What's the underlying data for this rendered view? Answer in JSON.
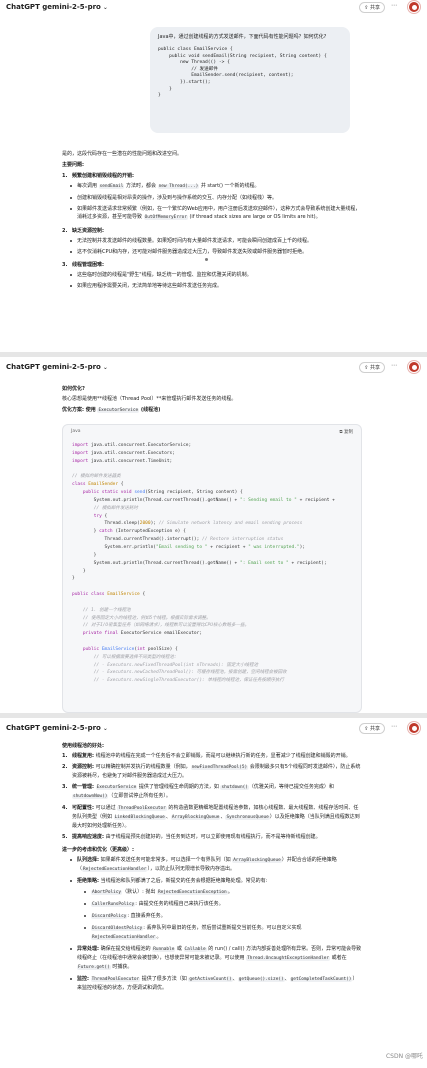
{
  "header": {
    "title": "ChatGPT gemini-2-5-pro",
    "chevron": "⌄",
    "share_label": "共享",
    "more": "⋯"
  },
  "panel1": {
    "question": "Java中，通过创建线程的方式发送邮件，下面代码有性能问题吗？如何优化?",
    "code_lines": [
      "public class EmailService {",
      "    public void sendEmail(String recipient, String content) {",
      "        new Thread(() -> {",
      "            // 发送邮件",
      "            EmailSender.send(recipient, content);",
      "        }).start();",
      "    }",
      "}"
    ],
    "intro": "是的，这段代码存在一些潜在的性能问题和改进空间。",
    "main_issues_heading": "主要问题:",
    "sections": [
      {
        "num": "1.",
        "heading": "频繁创建和销毁线程的开销:",
        "bullets": [
          {
            "pre": "每次调用 ",
            "code": "sendEmail",
            "mid": " 方法时，都会 ",
            "code2": "new Thread(...)",
            "post": " 并 start() 一个新的线程。"
          },
          {
            "pre": "创建和销毁线程是相对昂贵的操作，涉及到与操作系统的交互、内存分配（如线程栈）等。"
          },
          {
            "pre": "如果邮件发送请求非常频繁（例如，在一个繁忙的Web应用中，用户注册后发送欢迎邮件），这种方式会导致系统创建大量线程，消耗过多资源，甚至可能导致 ",
            "code": "OutOfMemoryError",
            "post": " (if thread stack sizes are large or OS limits are hit)。"
          }
        ]
      },
      {
        "num": "2.",
        "heading": "缺乏资源控制:",
        "bullets": [
          {
            "pre": "无法控制并发发送邮件的线程数量。如果短时间内有大量邮件发送请求，可能会瞬间创建成百上千的线程。"
          },
          {
            "pre": "这不仅消耗CPU和内存，还可能对邮件服务器造成过大压力，导致邮件发送失败或邮件服务器暂时拒绝。"
          }
        ]
      },
      {
        "num": "3.",
        "heading": "线程管理困难:",
        "bullets": [
          {
            "pre": "这些临时创建的线程是\"野生\"线程，缺乏统一的管理、监控和优雅关闭的机制。"
          },
          {
            "pre": "如果应用程序需要关闭，无法简单地等待这些邮件发送任务完成。"
          }
        ]
      }
    ]
  },
  "panel2": {
    "how_heading": "如何优化?",
    "core_idea": "核心思想是使用**线程池（Thread Pool）**来管理执行邮件发送任务的线程。",
    "scheme_label": "优化方案: 使用 ",
    "scheme_code": "ExecutorService",
    "scheme_suffix": " (线程池)",
    "code_lang": "Java",
    "copy_label": "复制"
  },
  "panel3": {
    "benefits_heading": "使用线程池的好处:",
    "benefits": [
      {
        "num": "1.",
        "head": "线程复用:",
        "text": " 线程池中的线程在完成一个任务后不会立即销毁，而是可以继续执行新的任务，显著减少了线程创建和销毁的开销。"
      },
      {
        "num": "2.",
        "head": "资源控制:",
        "text": " 可以精确控制并发执行的线程数量（例如，",
        "code": "newFixedThreadPool(5)",
        "text2": " 会限制最多只有5个线程同时发送邮件），防止系统资源被耗尽，也避免了对邮件服务器造成过大压力。"
      },
      {
        "num": "3.",
        "head": "统一管理:",
        "text": " ",
        "code": "ExecutorService",
        "text2": " 提供了管理线程生命周期的方法，如 ",
        "code2": "shutdown()",
        "text3": "（优雅关闭，等待已提交任务完成）和 ",
        "code3": "shutdownNow()",
        "text4": "（立即尝试停止所有任务）。"
      },
      {
        "num": "4.",
        "head": "可配置性:",
        "text": " 可以通过 ",
        "code": "ThreadPoolExecutor",
        "text2": " 的构造函数更精细地配置线程池参数，如核心线程数、最大线程数、线程存活时间、任务队列类型（例如 ",
        "code2": "LinkedBlockingQueue",
        "text3": "、",
        "code3": "ArrayBlockingQueue",
        "text4": "、",
        "code4": "SynchronousQueue",
        "text5": "）以及拒绝策略（当队列满且线程数达到最大时如何处理新任务）。"
      },
      {
        "num": "5.",
        "head": "提高响应速度:",
        "text": " 由于线程是预先创建好的，当任务到达时，可以立即使用现有线程执行，而不是等待新线程创建。"
      }
    ],
    "further_heading": "进一步的考虑和优化（更高级）:",
    "further": [
      {
        "head": "队列选择:",
        "text": " 如果邮件发送任务可能非常多，可以选择一个有界队列（如 ",
        "code": "ArrayBlockingQueue",
        "text2": "）并配合合适的拒绝策略（",
        "code2": "RejectedExecutionHandler",
        "text3": "），以防止队列无限增长导致内存溢出。"
      },
      {
        "head": "拒绝策略:",
        "text": " 当线程池和队列都满了之后，新提交的任务会根据拒绝策略处理。常见的有:"
      }
    ],
    "policies": [
      {
        "code": "AbortPolicy",
        "text": "（默认）: 抛出 ",
        "code2": "RejectedExecutionException",
        "text2": "。"
      },
      {
        "code": "CallerRunsPolicy",
        "text": ": 由提交任务的线程自己来执行该任务。"
      },
      {
        "code": "DiscardPolicy",
        "text": ": 直接丢弃任务。"
      },
      {
        "code": "DiscardOldestPolicy",
        "text": ": 丢弃队列中最旧的任务，然后尝试重新提交当前任务。可以自定义实现 ",
        "code2": "RejectedExecutionHandler",
        "text2": "。"
      }
    ],
    "more": [
      {
        "head": "异常处理:",
        "text": " 确保在提交给线程池的 ",
        "code": "Runnable",
        "text2": " 或 ",
        "code2": "Callable",
        "text3": " 的 run() / call() 方法内部妥善处理所有异常。否则，异常可能会导致线程终止（在线程池中通常会被替换），也想使异常可能未被记录。可以使用 ",
        "code3": "Thread.UncaughtExceptionHandler",
        "text4": " 或者在 ",
        "code4": "Future.get()",
        "text5": " 时捕获。"
      },
      {
        "head": "监控:",
        "text": " ",
        "code": "ThreadPoolExecutor",
        "text2": " 提供了很多方法（如 ",
        "code2": "getActiveCount()",
        "text3": "、",
        "code3": "getQueue().size()",
        "text4": "、",
        "code4": "getCompletedTaskCount()",
        "text5": "）来监控线程池的状态，方便调试和调优。"
      }
    ],
    "watermark": "CSDN @哪吒"
  },
  "colors": {
    "accent": "#c0392b",
    "user_bubble": "#eceff3",
    "code_bg": "#f6f7f9"
  }
}
